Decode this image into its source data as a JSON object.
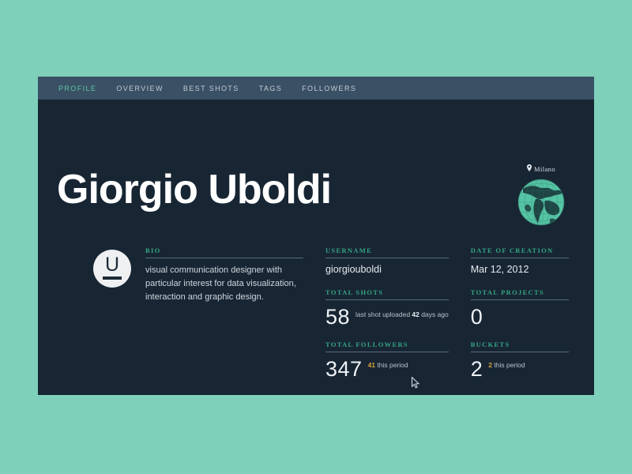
{
  "theme": {
    "page_background": "#7fd0ba",
    "card_background": "#182634",
    "navbar_background": "#3a5065",
    "accent_green": "#5ec9a6",
    "label_green": "#35a583",
    "highlight_amber": "#d6a03a",
    "text_light": "#cfd6dc",
    "rule": "#5b6b78"
  },
  "navbar": {
    "items": [
      {
        "label": "PROFILE",
        "active": true
      },
      {
        "label": "OVERVIEW",
        "active": false
      },
      {
        "label": "BEST SHOTS",
        "active": false
      },
      {
        "label": "TAGS",
        "active": false
      },
      {
        "label": "FOLLOWERS",
        "active": false
      }
    ]
  },
  "header": {
    "title": "Giorgio Uboldi"
  },
  "location": {
    "pin_icon": "map-pin-icon",
    "label": "Milano",
    "globe_icon": "globe-icon"
  },
  "avatar": {
    "icon": "avatar-logo-icon",
    "letter": "U"
  },
  "fields": {
    "bio": {
      "label": "BIO",
      "text": "visual communication designer with particular interest for data visualization, interaction and graphic design."
    },
    "username": {
      "label": "USERNAME",
      "value": "giorgiouboldi"
    },
    "total_shots": {
      "label": "TOTAL SHOTS",
      "value": "58",
      "note_before": "last shot uploaded ",
      "note_em": "42",
      "note_after": " days ago"
    },
    "total_followers": {
      "label": "TOTAL FOLLOWERS",
      "value": "347",
      "note_em": "41",
      "note_after": " this period"
    },
    "date_of_creation": {
      "label": "DATE OF CREATION",
      "value": "Mar 12, 2012"
    },
    "total_projects": {
      "label": "TOTAL PROJECTS",
      "value": "0"
    },
    "buckets": {
      "label": "BUCKETS",
      "value": "2",
      "note_em": "2",
      "note_after": " this period"
    }
  },
  "cursor": {
    "icon": "mouse-pointer-icon"
  }
}
